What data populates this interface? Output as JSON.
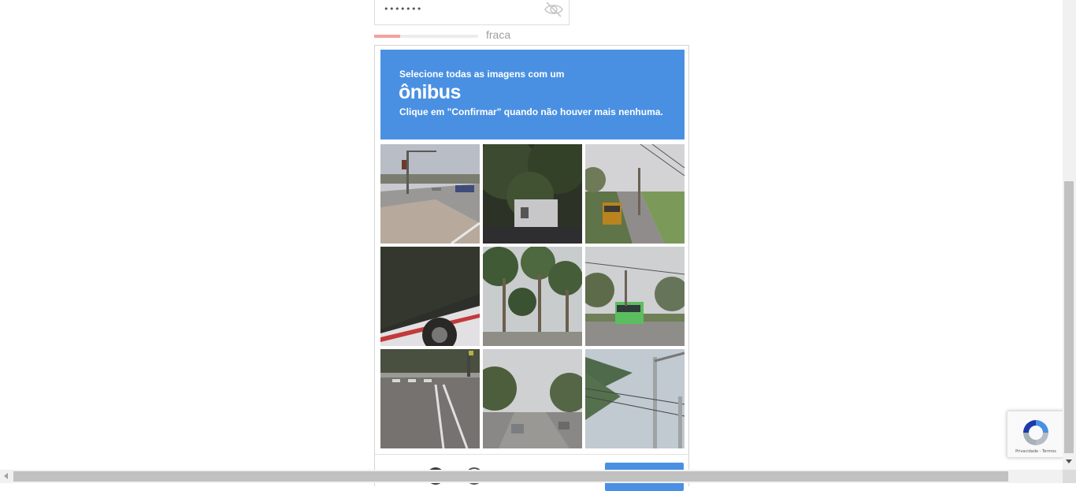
{
  "password": {
    "masked_value": "•••••••",
    "toggle_icon": "eye-off-icon"
  },
  "strength": {
    "label": "fraca",
    "level": 0.25,
    "color": "#f3a29d"
  },
  "captcha": {
    "header_color": "#4a90e2",
    "instruction": "Selecione todas as imagens com um",
    "keyword": "ônibus",
    "hint": "Clique em \"Confirmar\" quando não houver mais nenhuma.",
    "tiles": [
      {
        "content": "intersection with traffic light"
      },
      {
        "content": "trees and house"
      },
      {
        "content": "school bus on street"
      },
      {
        "content": "side of white bus with red stripe"
      },
      {
        "content": "palm trees"
      },
      {
        "content": "green bus on street"
      },
      {
        "content": "crosswalk"
      },
      {
        "content": "tree-lined street with cars"
      },
      {
        "content": "utility pole and palm"
      }
    ],
    "confirm_label": "",
    "footer_icons": [
      "reload-icon",
      "audio-icon",
      "info-icon"
    ]
  },
  "recaptcha_badge": {
    "links": "Privacidade - Termos",
    "logo_icon": "recaptcha-logo-icon"
  }
}
